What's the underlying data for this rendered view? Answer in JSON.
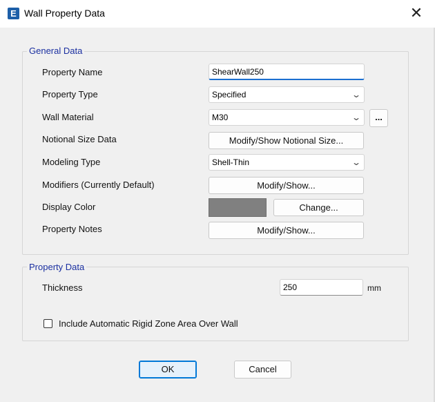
{
  "window": {
    "title": "Wall Property Data",
    "app_icon_letter": "E"
  },
  "general": {
    "legend": "General Data",
    "property_name": {
      "label": "Property Name",
      "value": "ShearWall250"
    },
    "property_type": {
      "label": "Property Type",
      "value": "Specified"
    },
    "wall_material": {
      "label": "Wall Material",
      "value": "M30",
      "more_button": "..."
    },
    "notional_size": {
      "label": "Notional Size Data",
      "button": "Modify/Show Notional Size..."
    },
    "modeling_type": {
      "label": "Modeling Type",
      "value": "Shell-Thin"
    },
    "modifiers": {
      "label": "Modifiers (Currently Default)",
      "button": "Modify/Show..."
    },
    "display_color": {
      "label": "Display Color",
      "button": "Change...",
      "color": "#808080"
    },
    "property_notes": {
      "label": "Property Notes",
      "button": "Modify/Show..."
    }
  },
  "property": {
    "legend": "Property Data",
    "thickness": {
      "label": "Thickness",
      "value": "250",
      "unit": "mm"
    },
    "rigid_zone": {
      "label": "Include Automatic Rigid Zone Area Over Wall",
      "checked": false
    }
  },
  "buttons": {
    "ok": "OK",
    "cancel": "Cancel"
  },
  "colors": {
    "accent": "#1a6fd0",
    "legend": "#1a2fa0",
    "ok_bg": "#e5f1fb",
    "ok_border": "#0078d7"
  }
}
